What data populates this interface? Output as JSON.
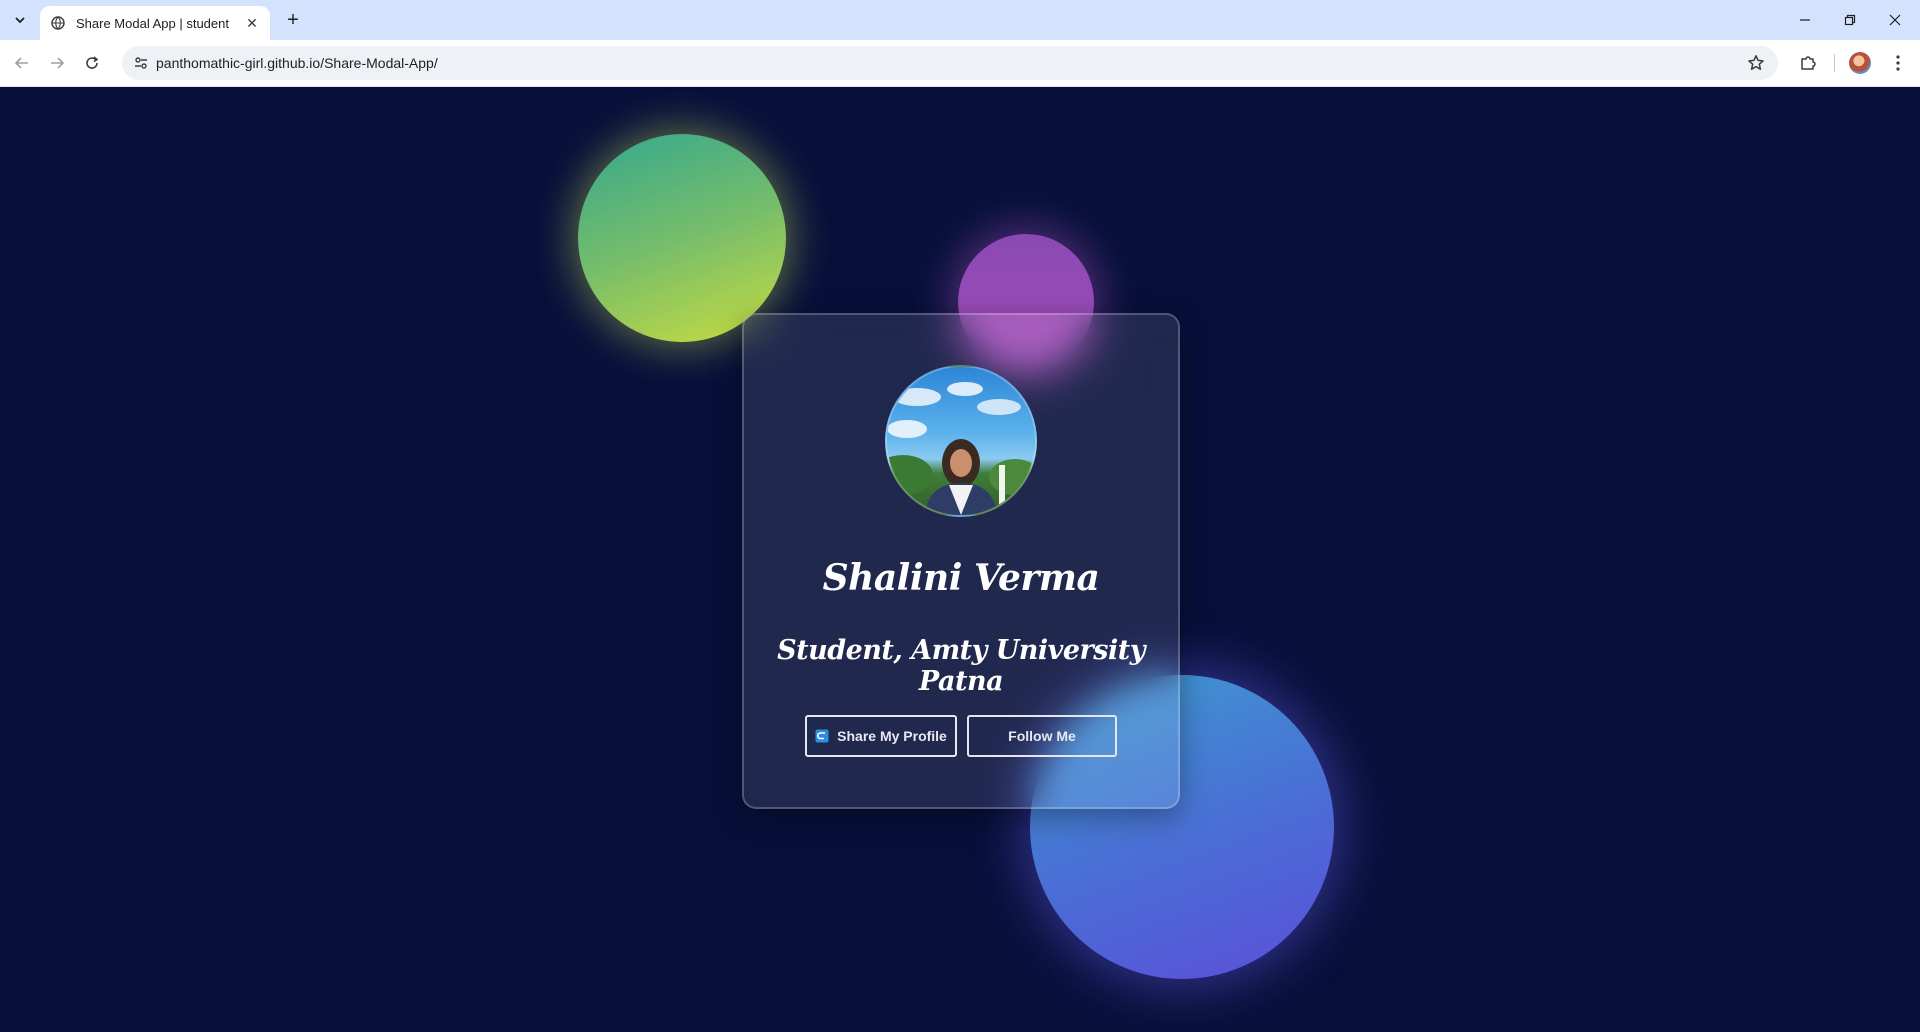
{
  "browser": {
    "tab": {
      "title": "Share Modal App | student"
    },
    "omnibox": {
      "url": "panthomathic-girl.github.io/Share-Modal-App/"
    }
  },
  "profile": {
    "name": "Shalini Verma",
    "role": "Student, Amty University Patna",
    "share_label": "Share My Profile",
    "follow_label": "Follow Me"
  },
  "colors": {
    "page_background": "#07103a",
    "blob_green": "#76bd6b",
    "blob_purple": "#8a49b4",
    "blob_blue": "#4a6dd6"
  }
}
